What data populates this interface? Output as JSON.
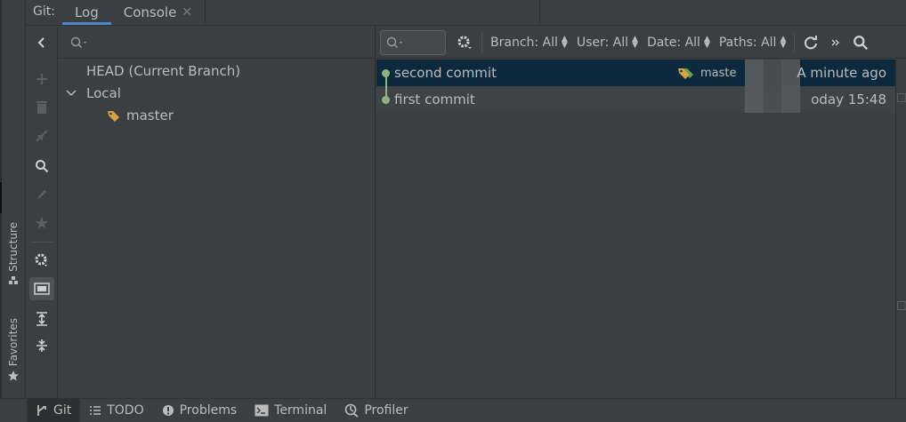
{
  "tabbar": {
    "prefix": "Git:",
    "tabs": [
      {
        "label": "Log",
        "active": true
      },
      {
        "label": "Console",
        "active": false,
        "closable": true
      }
    ]
  },
  "side_tabs": [
    {
      "label": "Structure",
      "icon": "structure-icon"
    },
    {
      "label": "Favorites",
      "icon": "star-icon"
    }
  ],
  "toolbar_icons": [
    "collapse-left-icon",
    "add-icon",
    "delete-icon",
    "merge-icon",
    "search-icon",
    "edit-icon",
    "favorite-star-icon",
    "settings-icon",
    "group-by-icon",
    "expand-all-icon",
    "collapse-all-icon"
  ],
  "branch_tree": {
    "search_placeholder": "",
    "items": [
      {
        "label": "HEAD (Current Branch)",
        "level": 0
      },
      {
        "label": "Local",
        "level": 0,
        "expanded": true
      },
      {
        "label": "master",
        "level": 1,
        "icon": "tag-icon"
      }
    ]
  },
  "log_toolbar": {
    "filters": [
      {
        "label": "Branch: All"
      },
      {
        "label": "User: All"
      },
      {
        "label": "Date: All"
      },
      {
        "label": "Paths: All"
      }
    ]
  },
  "commits": [
    {
      "subject": "second commit",
      "ref": "maste",
      "date": "A minute ago",
      "selected": true
    },
    {
      "subject": "first commit",
      "ref": "",
      "date": "oday 15:48",
      "selected": false
    }
  ],
  "bottom_tabs": [
    {
      "label": "Git",
      "icon": "git-branch-icon",
      "active": true
    },
    {
      "label": "TODO",
      "icon": "list-icon"
    },
    {
      "label": "Problems",
      "icon": "problems-icon"
    },
    {
      "label": "Terminal",
      "icon": "terminal-icon"
    },
    {
      "label": "Profiler",
      "icon": "profiler-icon"
    }
  ],
  "colors": {
    "accent": "#4a88c7",
    "graph": "#8fb37d",
    "tag": "#d9a343",
    "ref_tag_green": "#5fa54f",
    "selection": "#0d293e"
  }
}
